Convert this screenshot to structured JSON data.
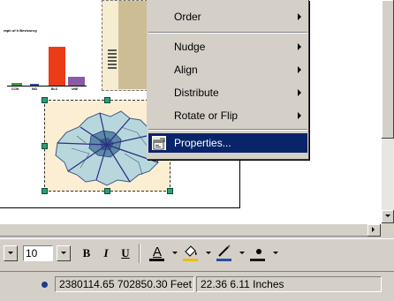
{
  "context_menu": {
    "items": [
      {
        "label": "Order",
        "submenu": true
      },
      {
        "label": "Nudge",
        "submenu": true
      },
      {
        "label": "Align",
        "submenu": true
      },
      {
        "label": "Distribute",
        "submenu": true
      },
      {
        "label": "Rotate or Flip",
        "submenu": true
      },
      {
        "label": "Properties...",
        "submenu": false,
        "highlighted": true,
        "icon": "properties-icon"
      }
    ]
  },
  "layout": {
    "chart_title": "raph of h Bevissncy",
    "chart_ticks": [
      "CCW",
      "IND",
      "BLS",
      "UNE"
    ]
  },
  "toolbar": {
    "font_size": "10",
    "bold_label": "B",
    "italic_label": "I",
    "underline_label": "U",
    "font_color_label": "A",
    "icons": [
      "font-color-icon",
      "fill-color-icon",
      "line-color-icon",
      "marker-color-icon"
    ]
  },
  "status": {
    "coordinates": "2380114.65  702850.30 Feet",
    "page_position": "22.36  6.11 Inches"
  },
  "colors": {
    "menu_highlight": "#0a246a",
    "chart_bar_red": "#ec3b17",
    "selection_handle": "#2f9e77",
    "font_color": "#000000",
    "fill_color": "#e6c200",
    "line_color": "#2b4e9c",
    "marker_color": "#1a1a1a"
  }
}
